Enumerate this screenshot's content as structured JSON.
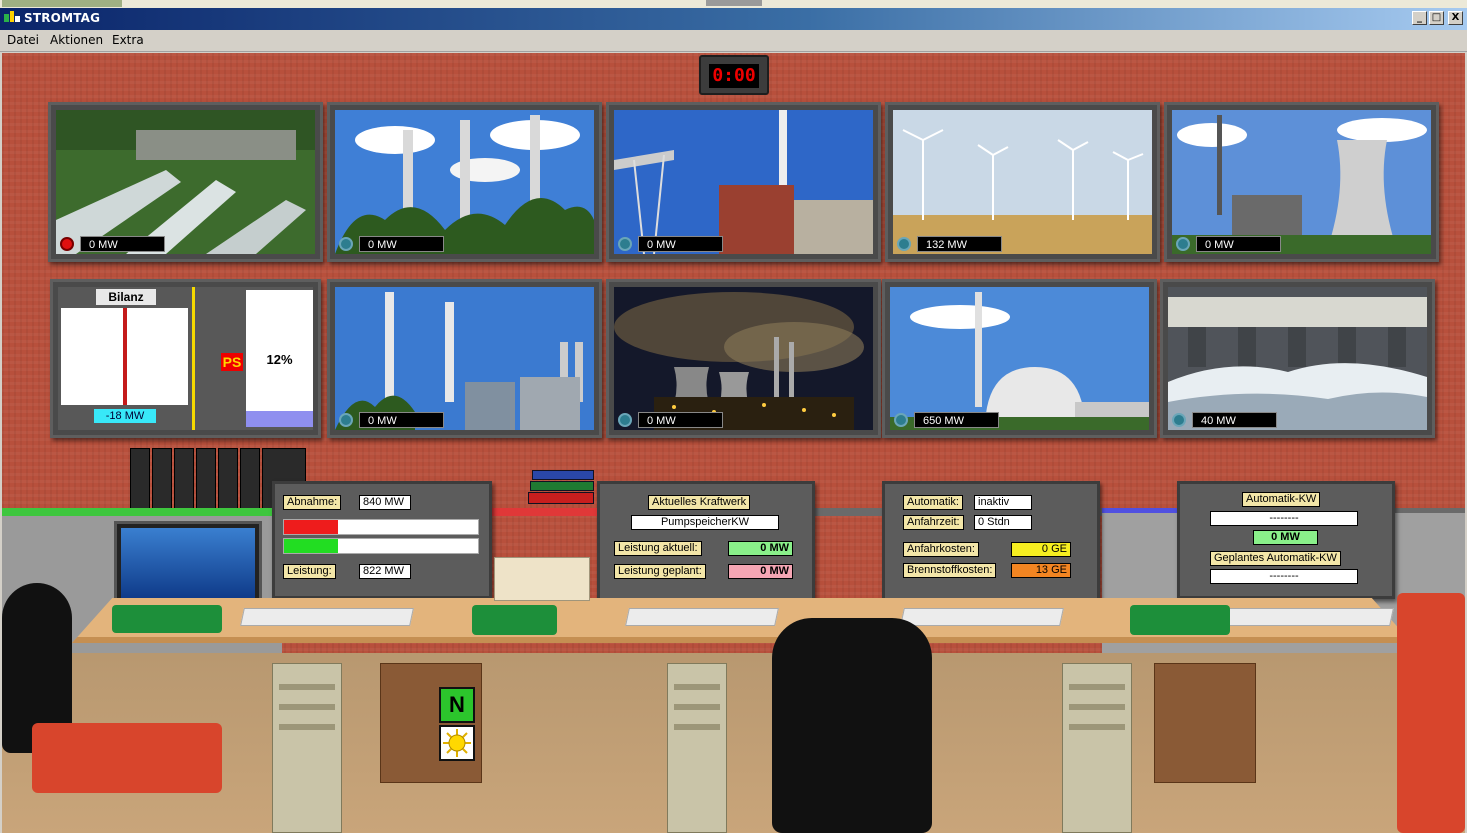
{
  "window": {
    "title": "STROMTAG",
    "controls": {
      "minimize": "_",
      "maximize": "□",
      "close": "X"
    }
  },
  "menu": [
    {
      "label": "Datei"
    },
    {
      "label": "Aktionen"
    },
    {
      "label": "Extra"
    }
  ],
  "clock": "0:00",
  "power_plants": [
    {
      "id": "pumped-storage",
      "output": "0 MW",
      "status": "active-red",
      "icon": "pipes-scene"
    },
    {
      "id": "coal-plant-1",
      "output": "0 MW",
      "status": "idle",
      "icon": "chimneys-scene"
    },
    {
      "id": "gas-plant",
      "output": "0 MW",
      "status": "idle",
      "icon": "factory-scene"
    },
    {
      "id": "wind-farm",
      "output": "132 MW",
      "status": "idle",
      "icon": "wind-turbine-scene"
    },
    {
      "id": "cooling-tower-plant",
      "output": "0 MW",
      "status": "idle",
      "icon": "cooling-tower-scene"
    },
    {
      "id": "industrial-plant",
      "output": "0 MW",
      "status": "idle",
      "icon": "chimneys-scene"
    },
    {
      "id": "lignite-plant",
      "output": "0 MW",
      "status": "idle",
      "icon": "night-plant-scene"
    },
    {
      "id": "nuclear-plant",
      "output": "650 MW",
      "status": "idle",
      "icon": "dome-scene"
    },
    {
      "id": "hydro-plant",
      "output": "40 MW",
      "status": "idle",
      "icon": "dam-scene"
    }
  ],
  "bilanz": {
    "title": "Bilanz",
    "value": "-18 MW",
    "ps_label": "PS",
    "ps_percent": "12%",
    "ps_fill_fraction": 0.12
  },
  "demand_panel": {
    "abnahme_label": "Abnahme:",
    "abnahme_value": "840 MW",
    "leistung_label": "Leistung:",
    "leistung_value": "822 MW",
    "demand_fraction": 0.28,
    "supply_fraction": 0.28,
    "demand_color": "#ee1c1c",
    "supply_color": "#22dd22"
  },
  "plant_panel": {
    "title": "Aktuelles Kraftwerk",
    "plant_name": "PumpspeicherKW",
    "leistung_aktuell_label": "Leistung aktuell:",
    "leistung_aktuell_value": "0 MW",
    "leistung_geplant_label": "Leistung geplant:",
    "leistung_geplant_value": "0 MW"
  },
  "cost_panel": {
    "automatik_label": "Automatik:",
    "automatik_value": "inaktiv",
    "anfahrzeit_label": "Anfahrzeit:",
    "anfahrzeit_value": "0 Stdn",
    "anfahrkosten_label": "Anfahrkosten:",
    "anfahrkosten_value": "0 GE",
    "brennstoffkosten_label": "Brennstoffkosten:",
    "brennstoffkosten_value": "13 GE"
  },
  "auto_panel": {
    "title": "Automatik-KW",
    "auto_kw_value": "--------",
    "auto_mw": "0 MW",
    "geplant_label": "Geplantes Automatik-KW",
    "geplant_value": "--------"
  },
  "weather": {
    "wind_direction": "N",
    "weather_icon": "sun-icon"
  }
}
